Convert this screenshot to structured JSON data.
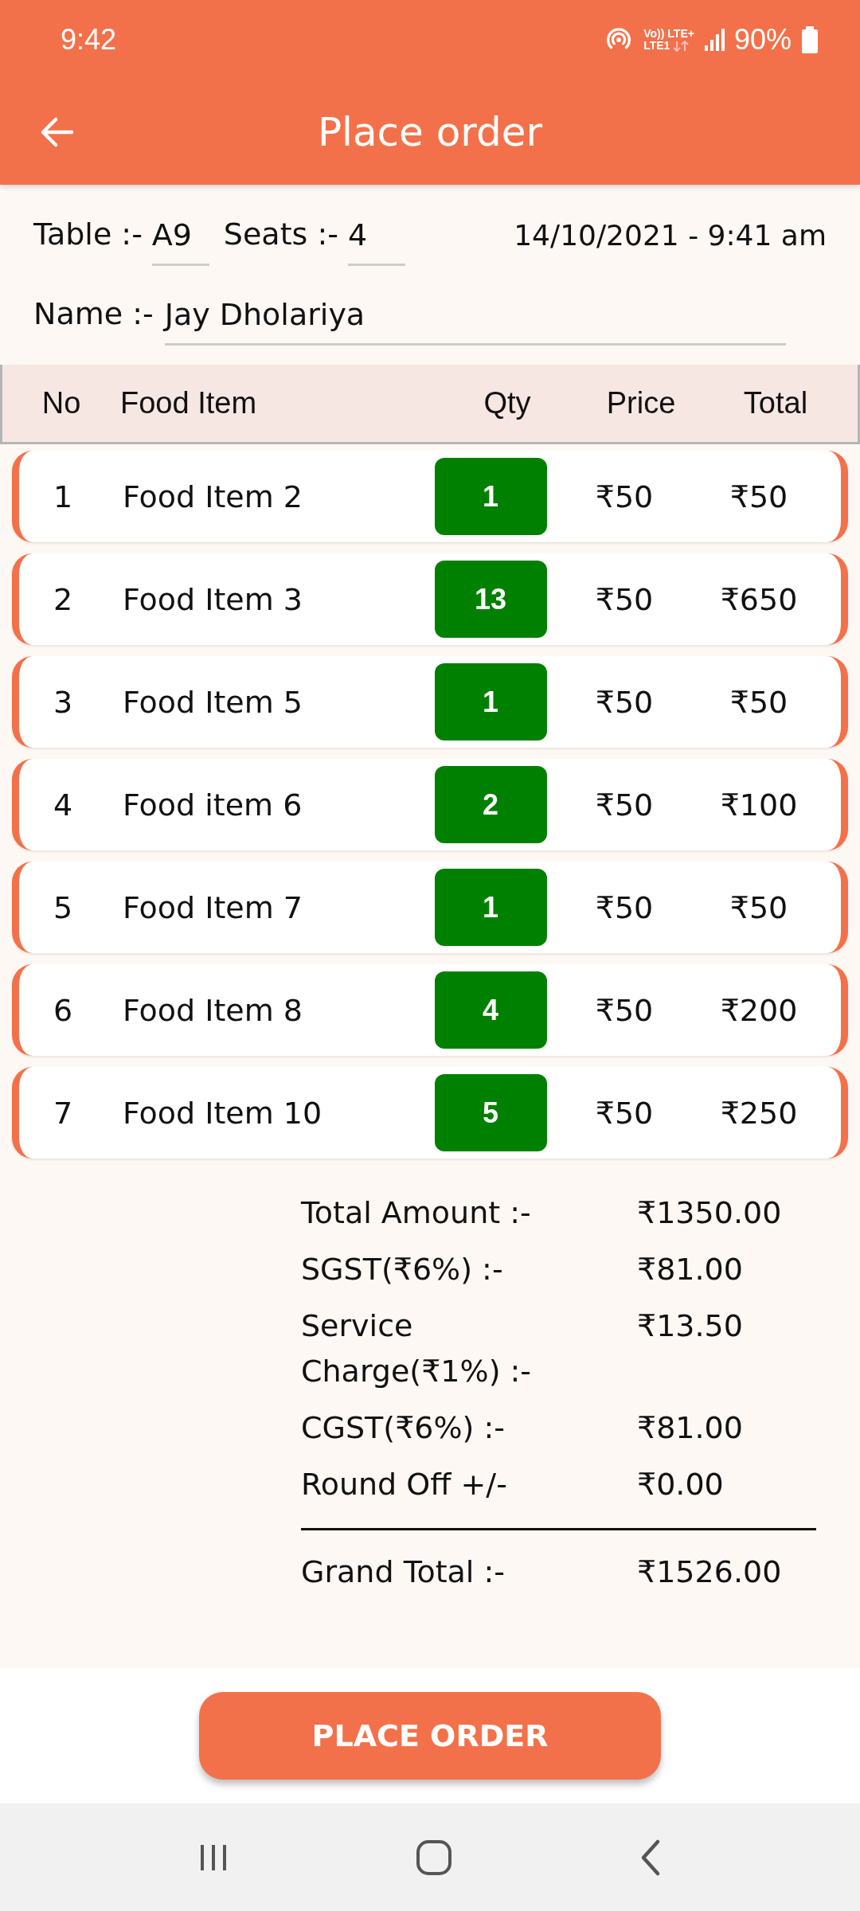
{
  "status_bar": {
    "time": "9:42",
    "volte": "Vo))",
    "lte_top": "LTE+",
    "lte_bottom": "LTE1",
    "battery": "90%"
  },
  "app_bar": {
    "title": "Place order"
  },
  "order_info": {
    "table_label": "Table :-",
    "table_value": "A9",
    "seats_label": "Seats :-",
    "seats_value": "4",
    "datetime": "14/10/2021 - 9:41 am",
    "name_label": "Name :-",
    "name_value": "Jay Dholariya"
  },
  "table": {
    "columns": [
      "No",
      "Food Item",
      "Qty",
      "Price",
      "Total"
    ],
    "rows": [
      {
        "no": "1",
        "item": "Food Item 2",
        "qty": "1",
        "price": "₹50",
        "total": "₹50"
      },
      {
        "no": "2",
        "item": "Food Item 3",
        "qty": "13",
        "price": "₹50",
        "total": "₹650"
      },
      {
        "no": "3",
        "item": "Food Item 5",
        "qty": "1",
        "price": "₹50",
        "total": "₹50"
      },
      {
        "no": "4",
        "item": "Food item 6",
        "qty": "2",
        "price": "₹50",
        "total": "₹100"
      },
      {
        "no": "5",
        "item": "Food Item 7",
        "qty": "1",
        "price": "₹50",
        "total": "₹50"
      },
      {
        "no": "6",
        "item": "Food Item 8",
        "qty": "4",
        "price": "₹50",
        "total": "₹200"
      },
      {
        "no": "7",
        "item": "Food Item 10",
        "qty": "5",
        "price": "₹50",
        "total": "₹250"
      }
    ]
  },
  "summary": {
    "lines": [
      {
        "label": "Total Amount :-",
        "value": "₹1350.00"
      },
      {
        "label": "SGST(₹6%) :-",
        "value": "₹81.00"
      },
      {
        "label": "Service Charge(₹1%) :-",
        "value": "₹13.50"
      },
      {
        "label": "CGST(₹6%) :-",
        "value": "₹81.00"
      },
      {
        "label": "Round Off +/-",
        "value": "₹0.00"
      }
    ],
    "grand_total": {
      "label": "Grand Total :-",
      "value": "₹1526.00"
    }
  },
  "primary_button": {
    "label": "PLACE ORDER"
  }
}
